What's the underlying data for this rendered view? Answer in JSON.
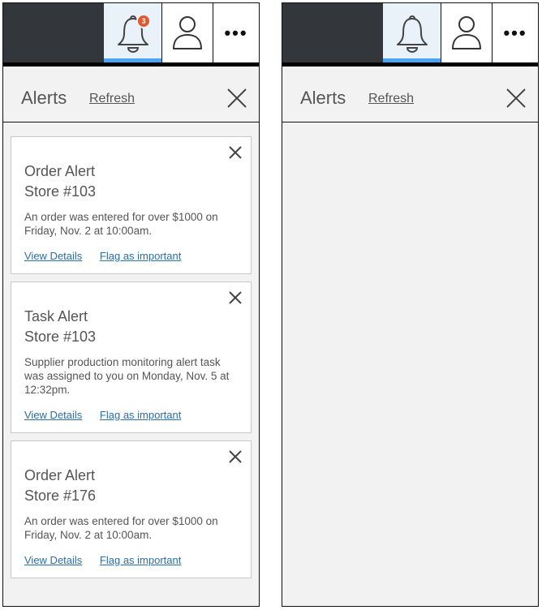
{
  "panels": [
    {
      "id": "left",
      "topbar": {
        "notification_count": "3",
        "icons": [
          "bell-icon",
          "user-icon",
          "more-icon"
        ],
        "more_label": "•••"
      },
      "header": {
        "title": "Alerts",
        "refresh_label": "Refresh"
      },
      "alerts": [
        {
          "type": "Order Alert",
          "store": "Store #103",
          "message": "An order was entered for over $1000 on Friday, Nov. 2 at 10:00am.",
          "view_label": "View Details",
          "flag_label": "Flag as important"
        },
        {
          "type": "Task Alert",
          "store": "Store #103",
          "message": "Supplier production monitoring alert task was assigned to you on Monday, Nov. 5 at 12:32pm.",
          "view_label": "View Details",
          "flag_label": "Flag as important"
        },
        {
          "type": "Order Alert",
          "store": "Store #176",
          "message": "An order was entered for over $1000 on Friday, Nov. 2 at 10:00am.",
          "view_label": "View Details",
          "flag_label": "Flag as important"
        }
      ]
    },
    {
      "id": "right",
      "topbar": {
        "icons": [
          "bell-icon",
          "user-icon",
          "more-icon"
        ],
        "more_label": "•••"
      },
      "header": {
        "title": "Alerts",
        "refresh_label": "Refresh"
      },
      "alerts": []
    }
  ],
  "colors": {
    "topbar_bg": "#33363b",
    "active_tab_bg": "#e9f1f9",
    "active_indicator": "#4da3f4",
    "badge": "#e4572e",
    "link": "#2a6ea6",
    "panel_bg": "#f2f2f2"
  }
}
